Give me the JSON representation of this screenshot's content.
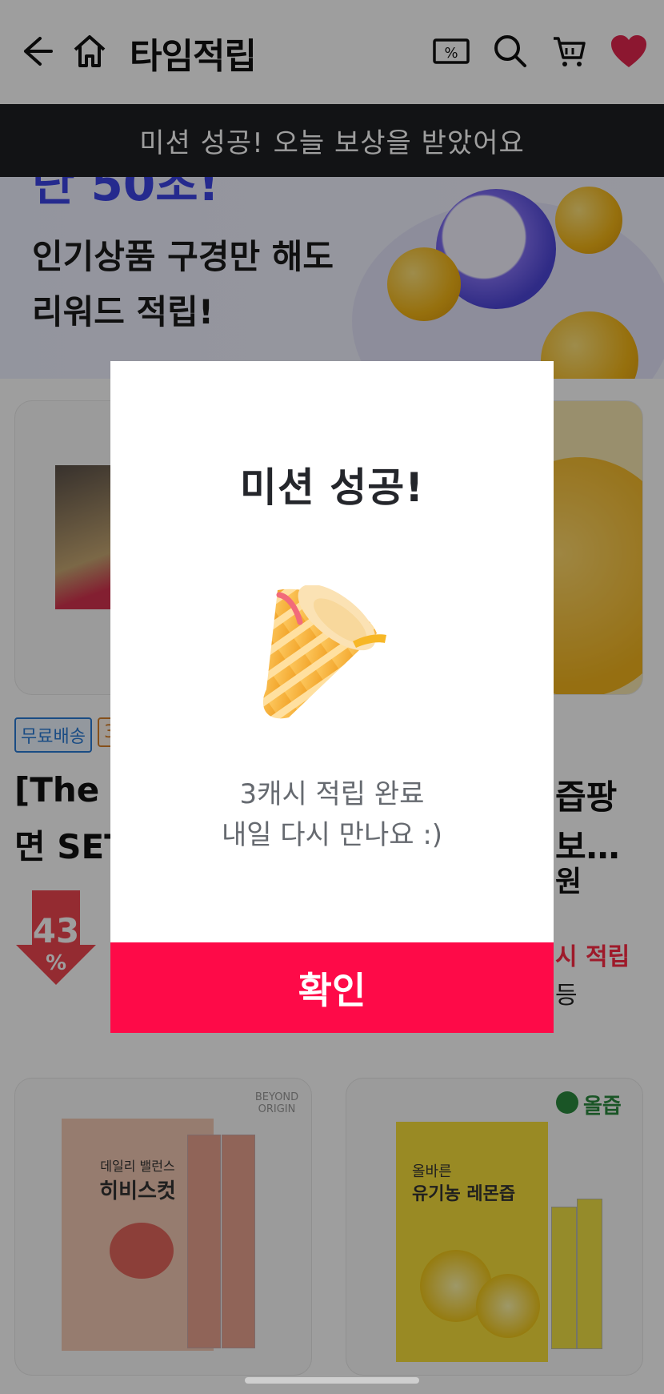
{
  "header": {
    "title": "타임적립",
    "back_icon": "arrow-left-icon",
    "home_icon": "home-icon",
    "coupon_icon": "coupon-icon",
    "coupon_symbol": "%",
    "search_icon": "search-icon",
    "cart_icon": "cart-icon",
    "heart_icon": "heart-icon"
  },
  "toast": {
    "text": "미션 성공! 오늘 보상을 받았어요"
  },
  "banner": {
    "top_text": "단 50초!",
    "line1": "인기상품 구경만 해도",
    "line2": "리워드 적립!"
  },
  "products": {
    "card1": {
      "badge_free": "무료배송",
      "badge_other": "3",
      "title_line1": "[The",
      "title_line2": "면 SET",
      "discount": "43",
      "discount_unit": "%"
    },
    "card2": {
      "title_line1": "즙팡",
      "title_line2": "보…",
      "price_unit": "원",
      "reward": "시 적립",
      "extra": "등"
    },
    "card3": {
      "brand": "BEYOND ORIGIN",
      "product_name": "히비스컷",
      "product_tag": "데일리 밸런스"
    },
    "card4": {
      "brand": "올즙",
      "product_name": "유기농 레몬즙",
      "product_tag": "올바른"
    }
  },
  "modal": {
    "title": "미션 성공!",
    "message_line1": "3캐시 적립 완료",
    "message_line2": "내일 다시 만나요 :)",
    "confirm_label": "확인",
    "illustration": "party-cone-icon"
  },
  "colors": {
    "confirm": "#fe0a48",
    "toast_bg": "#1e1f22",
    "banner_accent": "#3c44e6",
    "reward_red": "#ff2b45"
  }
}
